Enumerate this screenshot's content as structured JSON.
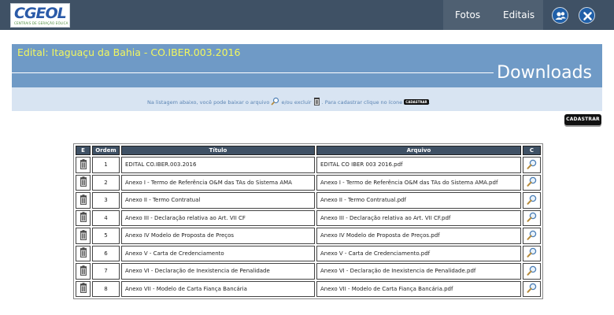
{
  "header": {
    "logo_text": "CGEOL",
    "logo_subtext": "CENTRAIS DE GERAÇÃO EÓLICA",
    "nav": [
      {
        "label": "Fotos"
      },
      {
        "label": "Editais"
      }
    ],
    "icons": [
      "users-icon",
      "close-icon"
    ]
  },
  "title_band": {
    "edital_title": "Edital: Itaguaçu da Bahia - CO.IBER.003.2016",
    "section_title": "Downloads"
  },
  "info": {
    "part1": "Na listagem abaixo, você pode baixar o arquivo",
    "part2": "e/ou excluir",
    "part3": ". Para cadastrar clique no ícone",
    "part4": ".",
    "mini_button": "CADASTRAR"
  },
  "cadastrar_button": "CADASTRAR",
  "table": {
    "headers": {
      "e": "E",
      "ordem": "Ordem",
      "titulo": "Título",
      "arquivo": "Arquivo",
      "c": "C"
    },
    "rows": [
      {
        "ordem": "1",
        "titulo": "EDITAL CO.IBER.003.2016",
        "arquivo": "EDITAL CO IBER 003 2016.pdf"
      },
      {
        "ordem": "2",
        "titulo": "Anexo I - Termo de Referência O&M das TAs do Sistema AMA",
        "arquivo": "Anexo I - Termo de Referência O&M das TAs do Sistema AMA.pdf"
      },
      {
        "ordem": "3",
        "titulo": "Anexo II - Termo Contratual",
        "arquivo": "Anexo II - Termo Contratual.pdf"
      },
      {
        "ordem": "4",
        "titulo": "Anexo III - Declaração relativa ao Art. VII CF",
        "arquivo": "Anexo III - Declaração relativa ao Art. VII CF.pdf"
      },
      {
        "ordem": "5",
        "titulo": "Anexo IV Modelo de Proposta de Preços",
        "arquivo": "Anexo IV Modelo de Proposta de Preços.pdf"
      },
      {
        "ordem": "6",
        "titulo": "Anexo V - Carta de Credenciamento",
        "arquivo": "Anexo V - Carta de Credenciamento.pdf"
      },
      {
        "ordem": "7",
        "titulo": "Anexo VI - Declaração de Inexistencia de Penalidade",
        "arquivo": "Anexo VI - Declaração de Inexistencia de Penalidade.pdf"
      },
      {
        "ordem": "8",
        "titulo": "Anexo VII - Modelo de Carta Fiança Bancária",
        "arquivo": "Anexo VII - Modelo de Carta Fiança Bancária.pdf"
      }
    ]
  },
  "colors": {
    "topbar": "#3f5165",
    "title_band": "#6f9ac6",
    "title_text": "#f2f75e",
    "info_band": "#d8e4f2",
    "table_header": "#3f5165"
  }
}
